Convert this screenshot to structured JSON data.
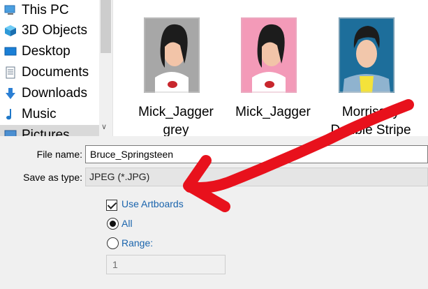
{
  "nav": {
    "items": [
      {
        "label": "This PC",
        "icon": "computer-icon"
      },
      {
        "label": "3D Objects",
        "icon": "cube-icon"
      },
      {
        "label": "Desktop",
        "icon": "desktop-icon"
      },
      {
        "label": "Documents",
        "icon": "document-icon"
      },
      {
        "label": "Downloads",
        "icon": "download-arrow-icon"
      },
      {
        "label": "Music",
        "icon": "music-note-icon"
      },
      {
        "label": "Pictures",
        "icon": "pictures-icon"
      }
    ]
  },
  "files": [
    {
      "name_line1": "Mick_Jagger",
      "name_line2": "grey"
    },
    {
      "name_line1": "Mick_Jagger",
      "name_line2": ""
    },
    {
      "name_line1": "Morrissey",
      "name_line2": "Double Stripe"
    }
  ],
  "form": {
    "filename_label": "File name:",
    "filename_value": "Bruce_Springsteen",
    "savetype_label": "Save as type:",
    "savetype_value": "JPEG (*.JPG)",
    "use_artboards_label": "Use Artboards",
    "use_artboards_checked": true,
    "all_label": "All",
    "range_label": "Range:",
    "range_value": "1",
    "selected_option": "All"
  },
  "colors": {
    "annotation_arrow": "#e8111c",
    "link_blue": "#1a64ad",
    "pink_bg": "#f39ab8",
    "blue_bg": "#1d6e9b"
  }
}
